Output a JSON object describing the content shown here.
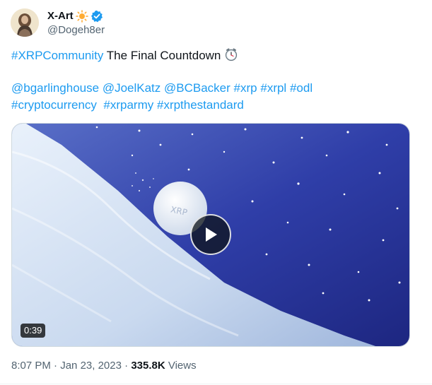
{
  "author": {
    "name": "X-Art",
    "handle": "@Dogeh8er",
    "name_emoji_icon": "sun-icon",
    "verified_icon": "verified-badge-icon"
  },
  "tweet": {
    "line1_hashtag": "#XRPCommunity",
    "line1_text": " The Final Countdown ",
    "line1_emoji_icon": "alarm-clock-icon",
    "line2": [
      {
        "text": "@bgarlinghouse",
        "kind": "mention"
      },
      {
        "text": " ",
        "kind": "space"
      },
      {
        "text": "@JoelKatz",
        "kind": "mention"
      },
      {
        "text": " ",
        "kind": "space"
      },
      {
        "text": "@BCBacker",
        "kind": "mention"
      },
      {
        "text": " ",
        "kind": "space"
      },
      {
        "text": "#xrp",
        "kind": "hashtag"
      },
      {
        "text": " ",
        "kind": "space"
      },
      {
        "text": "#xrpl",
        "kind": "hashtag"
      },
      {
        "text": " ",
        "kind": "space"
      },
      {
        "text": "#odl",
        "kind": "hashtag"
      }
    ],
    "line3": [
      {
        "text": "#cryptocurrency",
        "kind": "hashtag"
      },
      {
        "text": "  ",
        "kind": "space"
      },
      {
        "text": "#xrparmy",
        "kind": "hashtag"
      },
      {
        "text": " ",
        "kind": "space"
      },
      {
        "text": "#xrpthestandard",
        "kind": "hashtag"
      }
    ]
  },
  "media": {
    "duration": "0:39",
    "snowball_label": "XRP",
    "play_icon": "play-icon"
  },
  "meta": {
    "time": "8:07 PM",
    "sep1": " · ",
    "date": "Jan 23, 2023",
    "sep2": " · ",
    "views_count": "335.8K",
    "views_label": " Views"
  },
  "colors": {
    "link": "#1d9bf0",
    "text": "#0f1419",
    "secondary": "#536471",
    "verified": "#1d9bf0"
  }
}
